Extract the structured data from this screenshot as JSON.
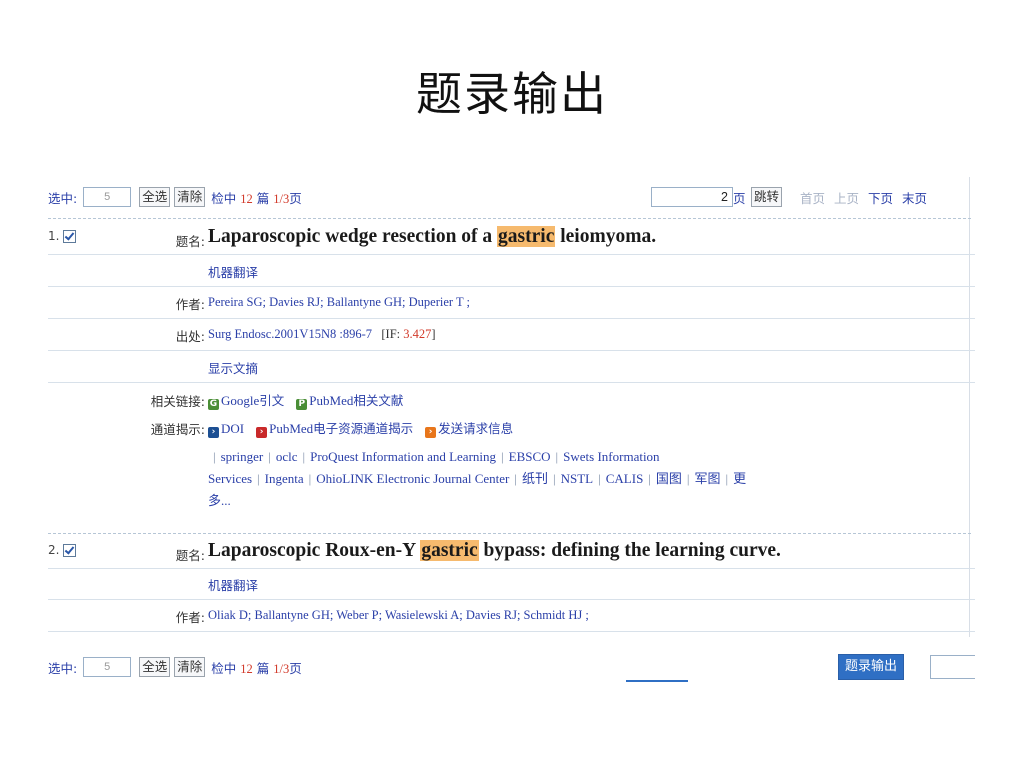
{
  "slide": {
    "title": "题录输出"
  },
  "toolbar_top": {
    "select_label": "选中:",
    "select_value": "5",
    "select_all": "全选",
    "clear": "清除",
    "hits_prefix": "检中",
    "hits_count": "12",
    "hits_unit": "篇",
    "page_info": "1/3",
    "page_unit": "页",
    "jump_value": "2",
    "jump_unit": "页",
    "jump_button": "跳转",
    "pager": {
      "first": "首页",
      "prev": "上页",
      "next": "下页",
      "last": "末页"
    }
  },
  "records": [
    {
      "number": "1.",
      "checked": true,
      "title_label": "题名:",
      "title_before": "Laparoscopic wedge resection of a ",
      "title_highlight": "gastric",
      "title_after": " leiomyoma.",
      "machine_translate": "机器翻译",
      "authors_label": "作者:",
      "authors": "Pereira SG; Davies RJ; Ballantyne GH; Duperier T ;",
      "source_label": "出处:",
      "source": "Surg Endosc.2001V15N8 :896-7",
      "if_label": "[IF:",
      "if_value": "3.427",
      "if_close": "]",
      "show_abstract": "显示文摘",
      "links_label": "相关链接:",
      "links": [
        {
          "icon": "G",
          "label": "Google",
          "suffix": "引文"
        },
        {
          "icon": "P",
          "label": "PubMed",
          "suffix": "相关文献"
        }
      ],
      "channels_label": "通道揭示:",
      "channel_links": [
        {
          "icon": "›",
          "label": "DOI"
        },
        {
          "icon": "›",
          "label": "PubMed",
          "suffix": "电子资源通道揭示"
        },
        {
          "icon": "›",
          "label": "发送请求信息"
        }
      ],
      "channel_line1": [
        "springer",
        "oclc",
        "ProQuest Information and Learning",
        "EBSCO",
        "Swets Information"
      ],
      "channel_line2": [
        "Services",
        "Ingenta",
        "OhioLINK Electronic Journal Center",
        "纸刊",
        "NSTL",
        "CALIS",
        "国图",
        "军图",
        "更"
      ],
      "channel_more": "多..."
    },
    {
      "number": "2.",
      "checked": true,
      "title_label": "题名:",
      "title_before": "Laparoscopic Roux-en-Y ",
      "title_highlight": "gastric",
      "title_after": " bypass: defining the learning curve.",
      "machine_translate": "机器翻译",
      "authors_label": "作者:",
      "authors": "Oliak D; Ballantyne GH; Weber P; Wasielewski A; Davies RJ; Schmidt HJ ;"
    }
  ],
  "toolbar_bottom": {
    "select_label": "选中:",
    "select_value": "5",
    "select_all": "全选",
    "clear": "清除",
    "hits_prefix": "检中",
    "hits_count": "12",
    "hits_unit": "篇",
    "page_info": "1/3",
    "page_unit": "页",
    "export_button": "题录输出"
  },
  "colors": {
    "link": "#2a3fa8",
    "accent_red": "#d23a2a",
    "highlight": "#f6ba6e",
    "export_button": "#2f6fc4"
  }
}
